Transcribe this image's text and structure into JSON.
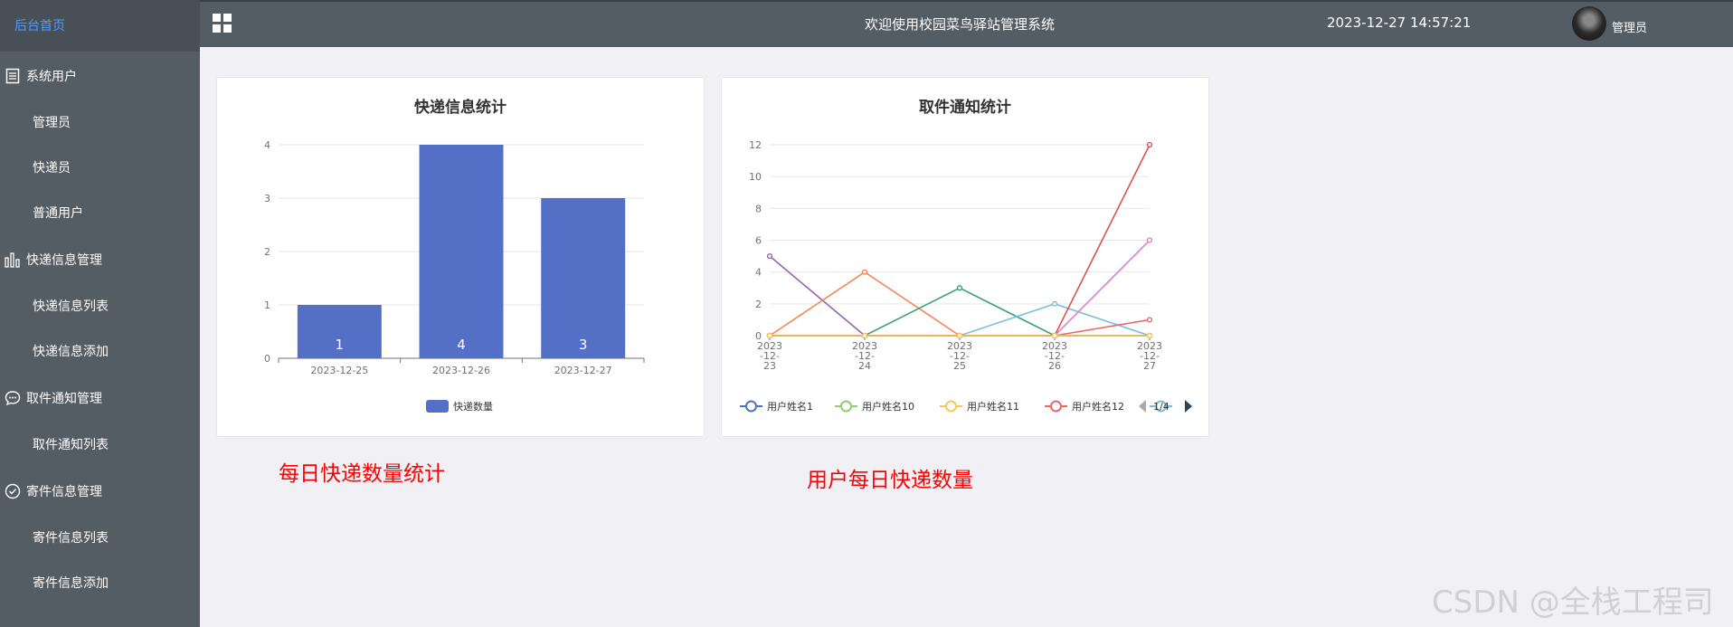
{
  "sidebar": {
    "home": "后台首页",
    "items": [
      {
        "label": "系统用户",
        "type": "group",
        "icon": "document-icon"
      },
      {
        "label": "管理员",
        "type": "sub"
      },
      {
        "label": "快递员",
        "type": "sub"
      },
      {
        "label": "普通用户",
        "type": "sub"
      },
      {
        "label": "快递信息管理",
        "type": "group",
        "icon": "bar-chart-icon"
      },
      {
        "label": "快递信息列表",
        "type": "sub"
      },
      {
        "label": "快递信息添加",
        "type": "sub"
      },
      {
        "label": "取件通知管理",
        "type": "group",
        "icon": "chat-bubble-icon"
      },
      {
        "label": "取件通知列表",
        "type": "sub"
      },
      {
        "label": "寄件信息管理",
        "type": "group",
        "icon": "check-circle-icon"
      },
      {
        "label": "寄件信息列表",
        "type": "sub"
      },
      {
        "label": "寄件信息添加",
        "type": "sub"
      }
    ]
  },
  "header": {
    "title": "欢迎使用校园菜鸟驿站管理系统",
    "datetime": "2023-12-27 14:57:21",
    "username": "管理员"
  },
  "colors": {
    "sidebar_bg": "#545c64",
    "accent": "#4e9bff",
    "bar": "#5470c6"
  },
  "annotations": {
    "left": "每日快递数量统计",
    "right": "用户每日快递数量"
  },
  "watermark": "CSDN @全栈工程司",
  "chart_data": [
    {
      "type": "bar",
      "title": "快递信息统计",
      "categories": [
        "2023-12-25",
        "2023-12-26",
        "2023-12-27"
      ],
      "series": [
        {
          "name": "快递数量",
          "values": [
            1,
            4,
            3
          ]
        }
      ],
      "ylim": [
        0,
        4
      ],
      "yticks": [
        0,
        1,
        2,
        3,
        4
      ],
      "grid": true,
      "legend": "bottom"
    },
    {
      "type": "line",
      "title": "取件通知统计",
      "categories": [
        "2023\n-12-\n23",
        "2023\n-12-\n24",
        "2023\n-12-\n25",
        "2023\n-12-\n26",
        "2023\n-12-\n27"
      ],
      "ylim": [
        0,
        12
      ],
      "yticks": [
        0,
        2,
        4,
        6,
        8,
        10,
        12
      ],
      "grid": true,
      "legend": "bottom",
      "legend_page": "1/4",
      "legend_items": [
        {
          "name": "用户姓名1",
          "color": "#5470c6"
        },
        {
          "name": "用户姓名10",
          "color": "#91cc75"
        },
        {
          "name": "用户姓名11",
          "color": "#fac858"
        },
        {
          "name": "用户姓名12",
          "color": "#ee6666"
        },
        {
          "name": "",
          "color": "#73c0de"
        }
      ],
      "series": [
        {
          "color": "#9a60b4",
          "values": [
            5,
            0,
            0,
            0,
            0
          ]
        },
        {
          "color": "#fc8452",
          "values": [
            0,
            4,
            0,
            0,
            0
          ]
        },
        {
          "color": "#3ba272",
          "values": [
            0,
            0,
            3,
            0,
            0
          ]
        },
        {
          "color": "#73c0de",
          "values": [
            0,
            0,
            0,
            2,
            0
          ]
        },
        {
          "color": "#ea7ccc",
          "values": [
            0,
            0,
            0,
            0,
            6
          ]
        },
        {
          "color": "#ee6666",
          "values": [
            0,
            0,
            0,
            0,
            1
          ]
        },
        {
          "color": "#d9534f",
          "values": [
            0,
            0,
            0,
            0,
            12
          ]
        },
        {
          "color": "#fac858",
          "values": [
            0,
            0,
            0,
            0,
            0
          ]
        }
      ]
    }
  ]
}
